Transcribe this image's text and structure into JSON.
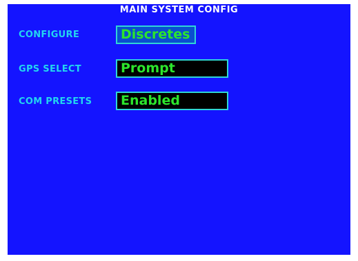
{
  "screen": {
    "title": "MAIN SYSTEM CONFIG"
  },
  "rows": [
    {
      "label": "CONFIGURE",
      "value": "Discretes"
    },
    {
      "label": "GPS SELECT",
      "value": "Prompt"
    },
    {
      "label": "COM PRESETS",
      "value": "Enabled"
    }
  ],
  "colors": {
    "background": "#1414ff",
    "label": "#22d6f0",
    "value_text": "#2ce62c",
    "field_border": "#2fd6d6",
    "field_selected_bg": "#0a4fd0",
    "field_bg": "#000000"
  }
}
